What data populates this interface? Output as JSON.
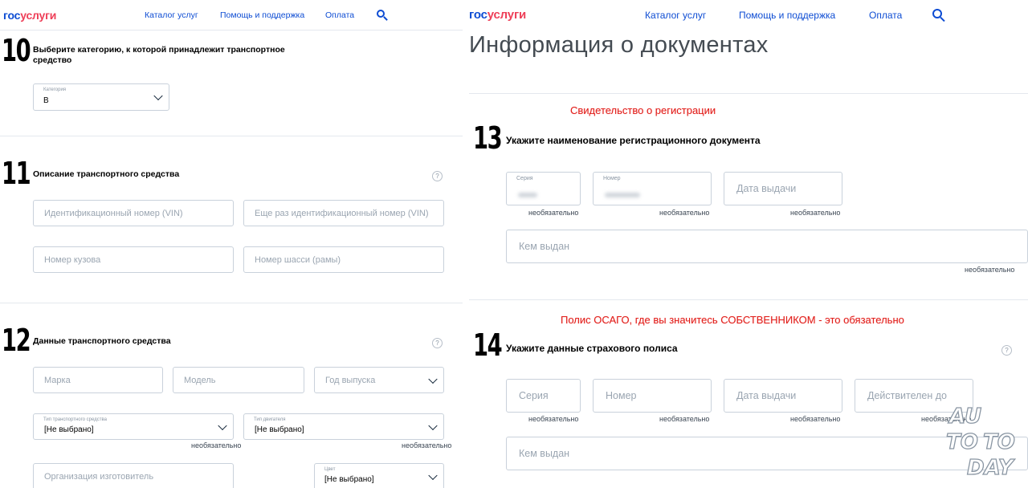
{
  "header": {
    "logo_gos": "гос",
    "logo_uslugi": "услуги",
    "nav": [
      "Каталог услуг",
      "Помощь и поддержка",
      "Оплата"
    ]
  },
  "left": {
    "step10": {
      "number": "10",
      "title_line1": "Выберите категорию, к которой принадлежит транспортное",
      "title_line2": "средство",
      "category_label": "Категория",
      "category_value": "B"
    },
    "step11": {
      "number": "11",
      "title": "Описание транспортного средства",
      "vin_placeholder": "Идентификационный номер (VIN)",
      "vin_repeat_placeholder": "Еще раз идентификационный номер (VIN)",
      "body_placeholder": "Номер кузова",
      "chassis_placeholder": "Номер шасси (рамы)"
    },
    "step12": {
      "number": "12",
      "title": "Данные транспортного средства",
      "make_placeholder": "Марка",
      "model_placeholder": "Модель",
      "year_placeholder": "Год выпуска",
      "vehicle_type_label": "Тип транспортного средства",
      "vehicle_type_value": "[Не выбрано]",
      "engine_type_label": "Тип двигателя",
      "engine_type_value": "[Не выбрано]",
      "optional": "необязательно",
      "manufacturer_placeholder": "Организация изготовитель",
      "color_label": "Цвет",
      "color_value": "[Не выбрано]"
    }
  },
  "right": {
    "page_title": "Информация о документах",
    "annotation1": "Свидетельство о регистрации",
    "step13": {
      "number": "13",
      "title": "Укажите наименование регистрационного документа",
      "series_label": "Серия",
      "number_label": "Номер",
      "issue_date_placeholder": "Дата выдачи",
      "issued_by_placeholder": "Кем выдан",
      "optional": "необязательно"
    },
    "annotation2": "Полис ОСАГО, где вы значитесь СОБСТВЕННИКОМ - это обязательно",
    "step14": {
      "number": "14",
      "title": "Укажите данные страхового полиса",
      "series_placeholder": "Серия",
      "number_placeholder": "Номер",
      "issue_date_placeholder": "Дата выдачи",
      "valid_until_placeholder": "Действителен до",
      "issued_by_placeholder": "Кем выдан",
      "optional": "необязательно"
    }
  },
  "watermark": [
    "AU",
    "TO",
    "TO",
    "DAY"
  ]
}
